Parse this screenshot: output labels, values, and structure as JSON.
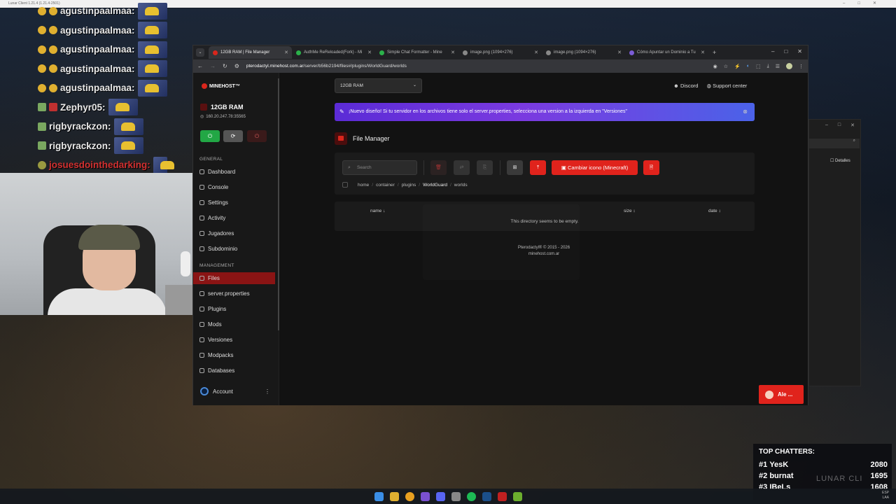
{
  "os": {
    "top_title": "Lunar Client 1.21.4 (1.21.4-2501)",
    "taskbar_icons": [
      "windows-icon",
      "explorer-icon",
      "chrome-icon",
      "obs-icon",
      "discord-icon",
      "app-icon",
      "spotify-icon",
      "steam-icon",
      "app-icon",
      "minecraft-icon"
    ],
    "tray_lang": "ESP",
    "tray_lang2": "LAA"
  },
  "stream": {
    "chat": [
      {
        "user": "agustinpaalmaa:",
        "color": "#e8e8e8"
      },
      {
        "user": "agustinpaalmaa:",
        "color": "#e8e8e8"
      },
      {
        "user": "agustinpaalmaa:",
        "color": "#e8e8e8"
      },
      {
        "user": "agustinpaalmaa:",
        "color": "#e8e8e8"
      },
      {
        "user": "agustinpaalmaa:",
        "color": "#e8e8e8"
      },
      {
        "user": "Zephyr05:",
        "color": "#e8e8e8"
      },
      {
        "user": "rigbyrackzon:",
        "color": "#e8e8e8"
      },
      {
        "user": "rigbyrackzon:",
        "color": "#e8e8e8"
      },
      {
        "user": "josuesdointhedarking:",
        "color": "#d13030"
      }
    ],
    "top_chatters": {
      "title": "TOP CHATTERS:",
      "rows": [
        {
          "rank": "#1",
          "name": "YesK",
          "count": "2080"
        },
        {
          "rank": "#2",
          "name": "burnat",
          "count": "1695"
        },
        {
          "rank": "#3",
          "name": "IBeLs",
          "count": "1608"
        }
      ]
    },
    "watermark": "LUNAR CLI"
  },
  "browser": {
    "tabs": [
      {
        "label": "12GB RAM | File Manager",
        "active": true
      },
      {
        "label": "AuthMe ReReloaded(Fork) - Mi",
        "active": false
      },
      {
        "label": "Simple Chat Formatter - Mine",
        "active": false
      },
      {
        "label": "image.png (1094×276)",
        "active": false
      },
      {
        "label": "image.png (1094×276)",
        "active": false
      },
      {
        "label": "Cómo Apuntar un Dominio a Tu",
        "active": false
      }
    ],
    "url_domain": "pterodactyl.minehost.com.ar",
    "url_path": "/server/b56b2194/files#/plugins/WorldGuard/worlds"
  },
  "panel": {
    "logo": "MINEHOST™",
    "server_name": "12GB RAM",
    "server_ip": "160.20.247.78:35565",
    "sections": {
      "general": "GENERAL",
      "management": "MANAGEMENT"
    },
    "nav_general": [
      "Dashboard",
      "Console",
      "Settings",
      "Activity",
      "Jugadores",
      "Subdominio"
    ],
    "nav_management": [
      "Files",
      "server.properties",
      "Plugins",
      "Mods",
      "Versiones",
      "Modpacks",
      "Databases"
    ],
    "account": "Account",
    "ram_select": "12GB RAM",
    "discord": "Discord",
    "support_center": "Support center",
    "banner": "¡Nuevo diseño! Si tu servidor en los archivos tiene solo el server.properties, selecciona una version a la izquierda en \"Versiones\"",
    "page_title": "File Manager",
    "search_placeholder": "Search",
    "cambiar_label": "Cambiar icono (Minecraft)",
    "breadcrumb": [
      "home",
      "container",
      "plugins",
      "WorldGuard",
      "worlds"
    ],
    "columns": {
      "name": "name ↓",
      "size": "size ↕",
      "date": "date ↕"
    },
    "empty_message": "This directory seems to be empty.",
    "footer_line1": "Pterodactyl® © 2015 - 2026",
    "footer_line2": "minehost.com.ar",
    "support_chat": "Ale ..."
  },
  "explorer": {
    "details": "Detalles"
  },
  "colors": {
    "accent_red": "#e0231c",
    "banner_purple": "#6a33dc",
    "active_nav": "#8a1414"
  }
}
